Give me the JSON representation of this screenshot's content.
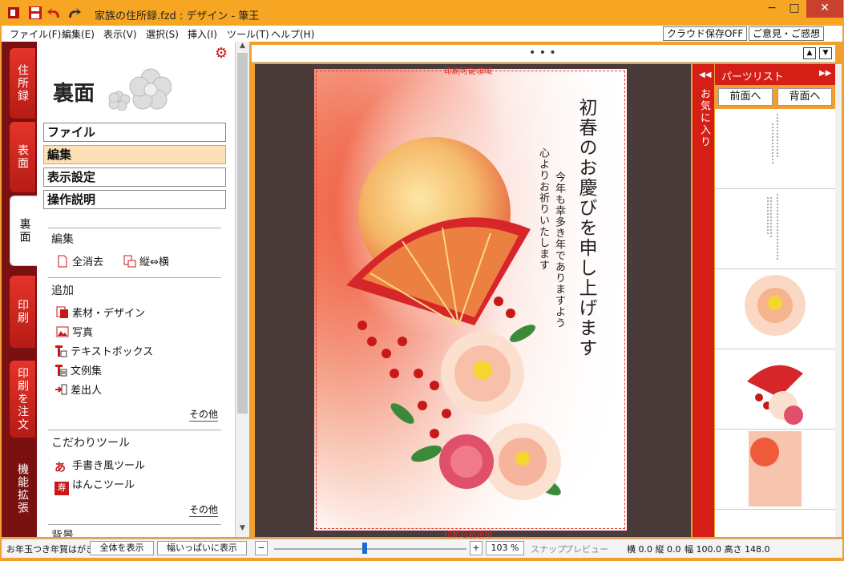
{
  "window": {
    "title": "家族の住所録.fzd : デザイン - 筆王"
  },
  "menu": [
    {
      "label": "ファイル(F)"
    },
    {
      "label": "編集(E)"
    },
    {
      "label": "表示(V)"
    },
    {
      "label": "選択(S)"
    },
    {
      "label": "挿入(I)"
    },
    {
      "label": "ツール(T)"
    },
    {
      "label": "ヘルプ(H)"
    }
  ],
  "top_buttons": {
    "cloud": "クラウド保存OFF",
    "feedback": "ご意見・ご感想"
  },
  "tabs": [
    "住所録",
    "表面",
    "裏面",
    "印刷",
    "印刷を注文",
    "機能拡張"
  ],
  "panel": {
    "title": "裏面",
    "menu": [
      "ファイル",
      "編集",
      "表示設定",
      "操作説明"
    ],
    "sections": {
      "edit": {
        "head": "編集",
        "items": [
          "全消去",
          "縦⇔横"
        ]
      },
      "add": {
        "head": "追加",
        "items": [
          "素材・デザイン",
          "写真",
          "テキストボックス",
          "文例集",
          "差出人"
        ],
        "more": "その他"
      },
      "tools": {
        "head": "こだわりツール",
        "items": [
          "手書き風ツール",
          "はんこツール"
        ],
        "more": "その他",
        "hanko_glyph": "寿"
      },
      "next_head": "背景"
    }
  },
  "card": {
    "area_top": "印刷可能領域",
    "area_bottom": "印刷可能領域",
    "greeting_main": "初春のお慶びを申し上げます",
    "greeting_sub1": "今年も幸多き年でありますよう",
    "greeting_sub2": "心よりお祈りいたします"
  },
  "parts": {
    "favorites": "お気に入り",
    "title": "パーツリスト",
    "front": "前面へ",
    "back": "背面へ"
  },
  "status": {
    "card_type": "お年玉つき年賀はがき",
    "fit_all": "全体を表示",
    "fit_width": "幅いっぱいに表示",
    "minus": "−",
    "plus": "+",
    "zoom": "103 %",
    "snap": "スナップ",
    "preview": "プレビュー",
    "coords": "横 0.0 縦 0.0",
    "size": "幅 100.0 高さ 148.0"
  },
  "colors": {
    "accent": "#d41e16",
    "titlebar": "#f6a623",
    "selected": "#fde0b5"
  }
}
